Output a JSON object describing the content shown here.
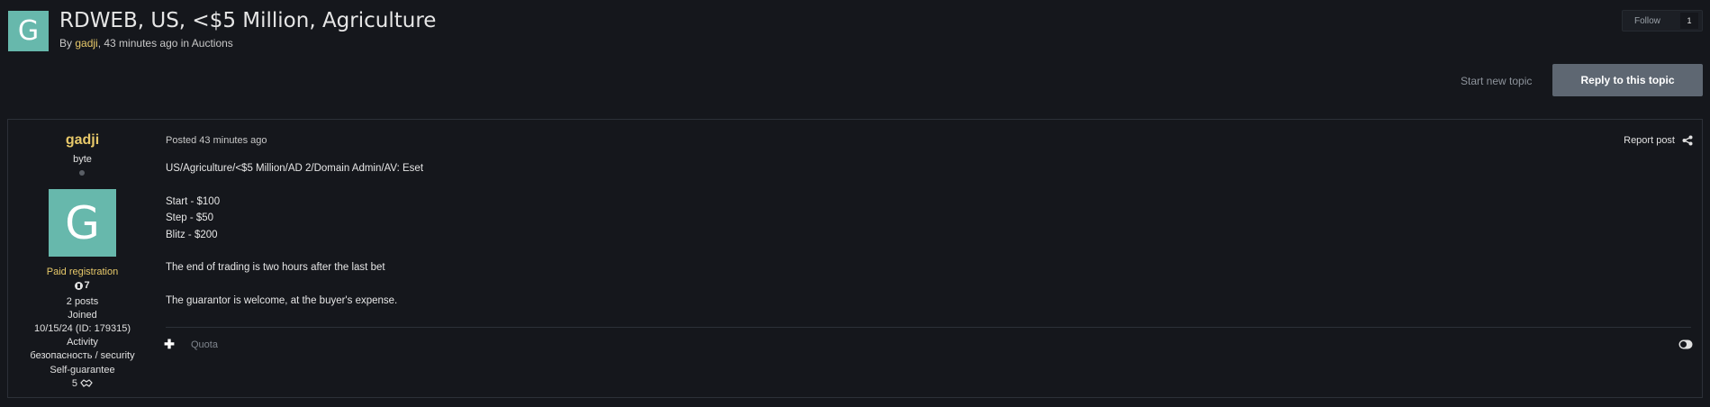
{
  "header": {
    "avatar_letter": "G",
    "title": "RDWEB, US, <$5 Million, Agriculture",
    "meta_prefix": "By ",
    "author": "gadji",
    "meta_suffix": ", 43 minutes ago in Auctions",
    "follow_label": "Follow",
    "follow_count": "1"
  },
  "actions": {
    "start_topic": "Start new topic",
    "reply": "Reply to this topic"
  },
  "post": {
    "author": {
      "name": "gadji",
      "rank": "byte",
      "avatar_letter": "G",
      "group": "Paid registration",
      "reputation": "7",
      "posts": "2 posts",
      "joined_label": "Joined",
      "joined_value": "10/15/24 (ID: 179315)",
      "activity_label": "Activity",
      "activity_value": "безопасность / security",
      "guarantee_label": "Self-guarantee",
      "guarantee_value": "5"
    },
    "date": "Posted 43 minutes ago",
    "report": "Report post",
    "body": [
      "US/Agriculture/<$5 Million/AD 2/Domain Admin/AV: Eset",
      "",
      "Start - $100",
      "Step - $50",
      "Blitz - $200",
      "",
      "The end of trading is two hours after the last bet",
      "",
      "The guarantor is welcome, at the buyer's expense."
    ],
    "quota": "Quota"
  },
  "icons": {
    "share": "share-icon",
    "plus": "plus-icon",
    "toggle": "toggle-icon",
    "reputation": "reputation-icon",
    "handshake": "handshake-icon"
  },
  "colors": {
    "background": "#15171c",
    "accent": "#e8c96a",
    "avatar": "#67b8ac",
    "reply_button": "#5e6772"
  }
}
